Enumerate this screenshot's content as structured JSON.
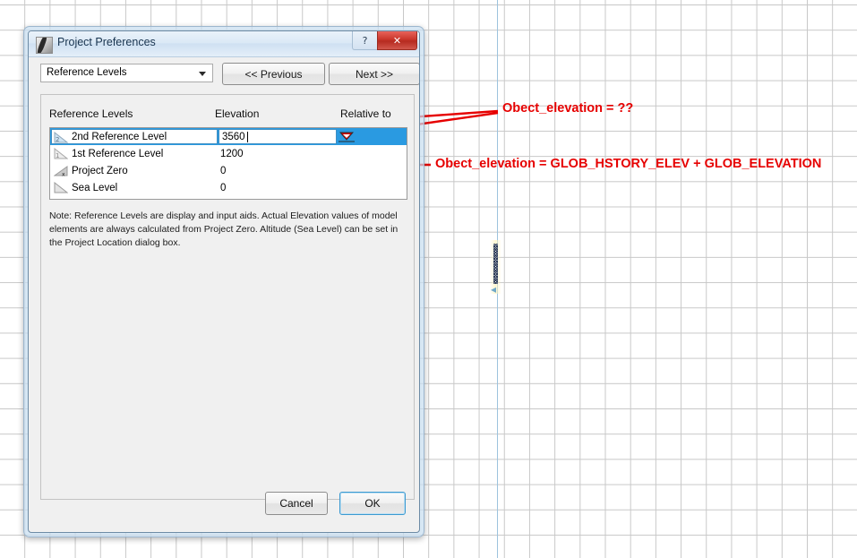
{
  "dialog": {
    "title": "Project Preferences",
    "app_icon": "archicad-app-icon",
    "window_buttons": {
      "help_label": "?",
      "close_label": "✕"
    },
    "page_select": {
      "value": "Reference Levels",
      "options": [
        "Reference Levels"
      ]
    },
    "prev_label": "<< Previous",
    "next_label": "Next >>",
    "columns": {
      "levels": "Reference Levels",
      "elevation": "Elevation",
      "relative_to": "Relative to"
    },
    "rows": [
      {
        "name": "2nd Reference Level",
        "elevation": "3560",
        "icon": "level-2-icon",
        "selected": true,
        "editing": true,
        "relative_marker": ""
      },
      {
        "name": "1st Reference Level",
        "elevation": "1200",
        "icon": "level-1-icon",
        "selected": false,
        "editing": false,
        "relative_marker": ""
      },
      {
        "name": "Project Zero",
        "elevation": "0",
        "icon": "project-zero-icon",
        "selected": false,
        "editing": false,
        "relative_marker": "datum-triangle"
      },
      {
        "name": "Sea Level",
        "elevation": "0",
        "icon": "sea-level-icon",
        "selected": false,
        "editing": false,
        "relative_marker": ""
      }
    ],
    "editor_value": "3560",
    "note": "Note: Reference Levels are display and input aids. Actual Elevation values of model elements are always calculated from Project Zero. Altitude (Sea Level) can be set in the Project Location dialog box.",
    "cancel_label": "Cancel",
    "ok_label": "OK"
  },
  "annotations": {
    "color": "#e60000",
    "items": [
      {
        "text": "Obect_elevation = ??"
      },
      {
        "text": "Obect_elevation = GLOB_HSTORY_ELEV  + GLOB_ELEVATION"
      }
    ]
  },
  "canvas": {
    "grid_color": "#c8c8c8",
    "guide_color": "#9dc3de"
  }
}
